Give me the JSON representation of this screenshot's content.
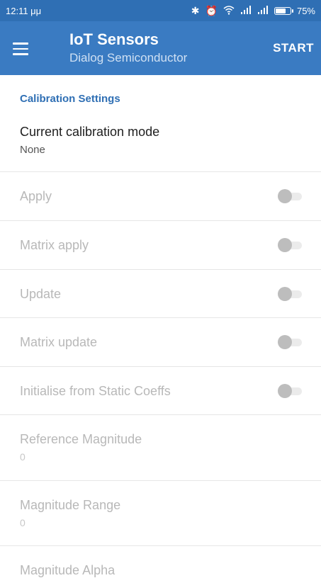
{
  "status_bar": {
    "time": "12:11 μμ",
    "icons": [
      "bluetooth-icon",
      "alarm-icon",
      "wifi-icon",
      "signal-icon",
      "signal-icon",
      "battery-icon"
    ],
    "battery_level": 75,
    "battery_text": "75%"
  },
  "app_bar": {
    "menu_icon": "hamburger-menu-icon",
    "title": "IoT Sensors",
    "subtitle": "Dialog Semiconductor",
    "action": "START",
    "background_color": "#3a7bc2"
  },
  "settings": {
    "section_title": "Calibration Settings",
    "current_mode": {
      "title": "Current calibration mode",
      "value": "None"
    },
    "toggles": [
      {
        "label": "Apply",
        "checked": false,
        "enabled": false
      },
      {
        "label": "Matrix apply",
        "checked": false,
        "enabled": false
      },
      {
        "label": "Update",
        "checked": false,
        "enabled": false
      },
      {
        "label": "Matrix update",
        "checked": false,
        "enabled": false
      },
      {
        "label": "Initialise from Static Coeffs",
        "checked": false,
        "enabled": false
      }
    ],
    "values": [
      {
        "label": "Reference Magnitude",
        "value": "0",
        "enabled": false
      },
      {
        "label": "Magnitude Range",
        "value": "0",
        "enabled": false
      },
      {
        "label": "Magnitude Alpha",
        "enabled": false
      }
    ]
  }
}
